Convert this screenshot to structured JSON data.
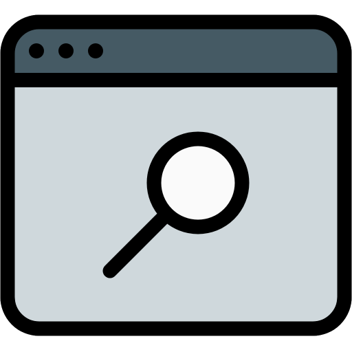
{
  "icon": {
    "name": "browser-search-icon",
    "colors": {
      "outline": "#000000",
      "title_bar": "#455a64",
      "window_body": "#cfd8dc",
      "lens_glass": "#fafafa"
    }
  }
}
